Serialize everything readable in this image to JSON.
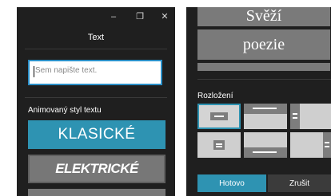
{
  "left": {
    "window_controls": [
      "–",
      "❐",
      "✕"
    ],
    "title": "Text",
    "text_input": {
      "value": "",
      "placeholder": "Sem napište text."
    },
    "animated_style_label": "Animovaný styl textu",
    "styles": [
      "KLASICKÉ",
      "ELEKTRICKÉ",
      ""
    ]
  },
  "right": {
    "styles": [
      "Svěží",
      "poezie",
      ""
    ],
    "layout_label": "Rozložení",
    "layouts": [
      {
        "icon": "layout-center-box-icon",
        "selected": true
      },
      {
        "icon": "layout-top-bar-icon",
        "selected": false
      },
      {
        "icon": "layout-left-equals-icon",
        "selected": false
      },
      {
        "icon": "layout-center-small-box-icon",
        "selected": false
      },
      {
        "icon": "layout-bottom-bar-icon",
        "selected": false
      },
      {
        "icon": "layout-right-equals-icon",
        "selected": false
      }
    ],
    "done_label": "Hotovo",
    "cancel_label": "Zrušit"
  },
  "colors": {
    "panel_bg": "#1f1f1f",
    "accent": "#2e93b2",
    "input_border": "#2a8fc8",
    "tile_bg": "#cfcfcf",
    "style_button_bg": "#777777"
  }
}
